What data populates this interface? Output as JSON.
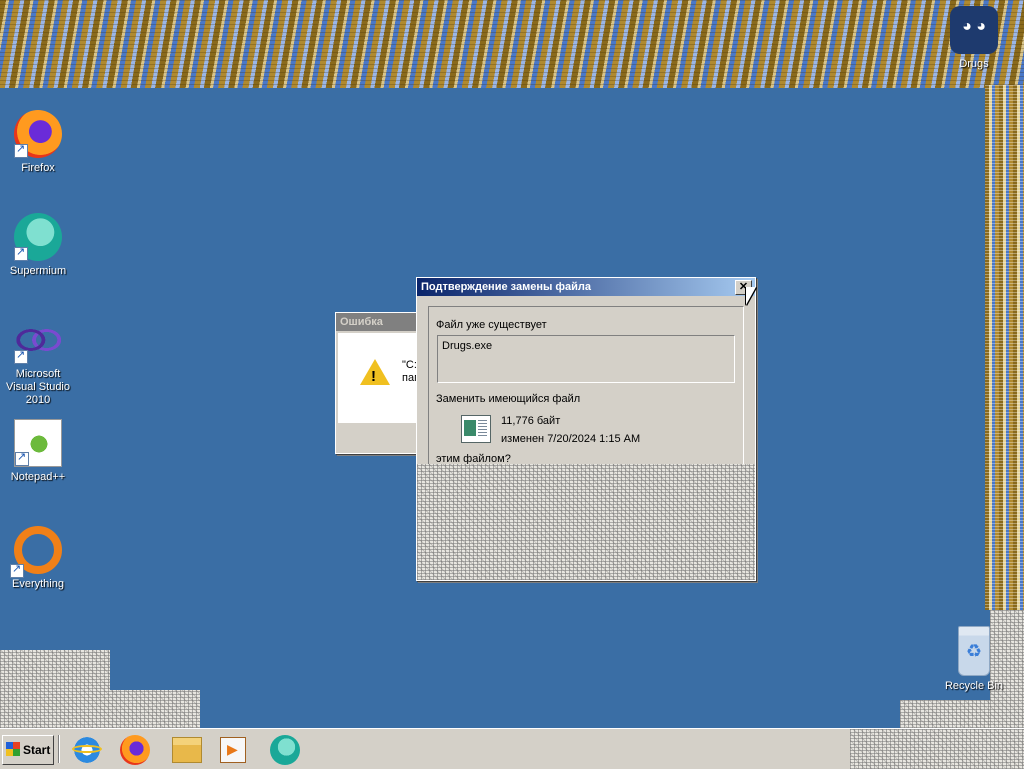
{
  "desktop": {
    "icons": [
      {
        "label": "Drugs",
        "icon": "drugs-app-icon"
      },
      {
        "label": "Firefox",
        "icon": "firefox-icon"
      },
      {
        "label": "Supermium",
        "icon": "supermium-icon"
      },
      {
        "label": "Microsoft Visual Studio 2010",
        "icon": "visual-studio-icon"
      },
      {
        "label": "Notepad++",
        "icon": "notepad-plus-plus-icon"
      },
      {
        "label": "Everything",
        "icon": "everything-icon"
      },
      {
        "label": "Recycle Bin",
        "icon": "recycle-bin-icon"
      }
    ]
  },
  "error_dialog": {
    "title": "Ошибка",
    "message_line1": "\"C:",
    "message_line2": "пап"
  },
  "confirm_dialog": {
    "title": "Подтверждение замены файла",
    "close_label": "✕",
    "exists_label": "Файл уже существует",
    "existing_file_name": "Drugs.exe",
    "replace_label": "Заменить имеющийся файл",
    "file_size": "11,776 байт",
    "file_modified": "изменен 7/20/2024 1:15 AM",
    "with_label": "этим файлом?"
  },
  "taskbar": {
    "start_label": "Start",
    "pinned": [
      "internet-explorer-icon",
      "firefox-icon",
      "file-explorer-icon",
      "media-player-icon",
      "supermium-icon"
    ]
  },
  "colors": {
    "desktop_bg": "#3a6ea5",
    "titlebar_active_start": "#0a246a",
    "titlebar_active_end": "#a6caf0",
    "window_face": "#d4d0c8"
  }
}
